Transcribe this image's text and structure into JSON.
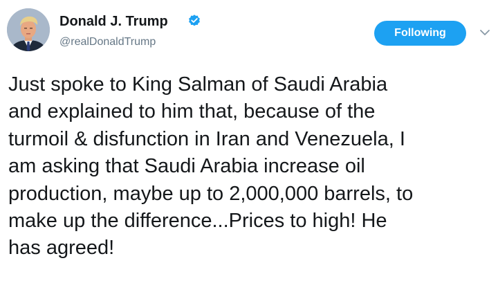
{
  "author": {
    "display_name": "Donald J. Trump",
    "handle": "@realDonaldTrump",
    "verified": true
  },
  "follow_button": {
    "label": "Following"
  },
  "icons": {
    "verified": "verified-badge-icon",
    "caret": "chevron-down-icon",
    "avatar": "profile-avatar"
  },
  "tweet": {
    "text": "Just spoke to King Salman of Saudi Arabia\nand explained to him that, because of the\nturmoil & disfunction in Iran and Venezuela, I\nam asking that Saudi Arabia increase oil\nproduction, maybe up to 2,000,000 barrels, to\nmake up the difference...Prices to high! He\nhas agreed!"
  },
  "colors": {
    "accent": "#1da1f2",
    "text": "#14171a",
    "secondary_text": "#657786",
    "background": "#ffffff"
  }
}
